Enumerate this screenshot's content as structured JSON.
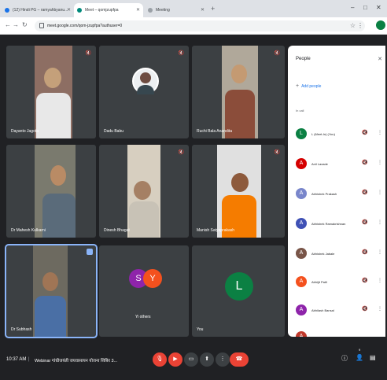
{
  "browser": {
    "tabs": [
      {
        "label": "(12) Hindi PG – ramyahbyanu...",
        "favicon_color": "#1a73e8"
      },
      {
        "label": "Meet – qomjzupfpa",
        "favicon_color": "#00897b"
      },
      {
        "label": "Meeting",
        "favicon_color": "#9aa0a6"
      }
    ],
    "url": "meet.google.com/qom-jzupfpa?authuser=0"
  },
  "tiles": [
    {
      "name": "Dayanto Jagota"
    },
    {
      "name": "Dadu Babu"
    },
    {
      "name": "Ruchi Bala Anandita"
    },
    {
      "name": "Dr Mahesh Kulkarni"
    },
    {
      "name": "Dinesh Bhagat"
    },
    {
      "name": "Manish Satyaprakash"
    },
    {
      "name": "Dr Subhash"
    },
    {
      "name": "Yi others",
      "avatars": [
        "S",
        "Y"
      ]
    },
    {
      "name": "You",
      "avatars": [
        "L"
      ]
    }
  ],
  "people": {
    "title": "People",
    "add_people": "Add people",
    "section": "In call",
    "list": [
      {
        "initial": "L",
        "name": "L (Meet-In) (You)",
        "color": "#0b8043"
      },
      {
        "initial": "A",
        "name": "Anil Laxade",
        "color": "#d50000"
      },
      {
        "initial": "A",
        "name": "Abhishek Prakash",
        "color": "#7986cb"
      },
      {
        "initial": "A",
        "name": "Abhishek Ramakrishnan",
        "color": "#3f51b5"
      },
      {
        "initial": "A",
        "name": "Abhishek Jabale",
        "color": "#795548"
      },
      {
        "initial": "A",
        "name": "Abhijit Patil",
        "color": "#f4511e"
      },
      {
        "initial": "A",
        "name": "Abhilash Bansal",
        "color": "#8e24aa"
      },
      {
        "initial": "A",
        "name": "",
        "color": "#c0392b"
      }
    ]
  },
  "bottombar": {
    "time": "10:37 AM",
    "separator": "|",
    "meeting": "Webinar गांधीजयंती जयवासायन योजना शिबिर 3..."
  },
  "icons": {
    "mic": "🎙",
    "more": "⋮",
    "close": "✕",
    "add": "👤+",
    "info": "ⓘ",
    "people": "👥",
    "chat": "💬"
  }
}
